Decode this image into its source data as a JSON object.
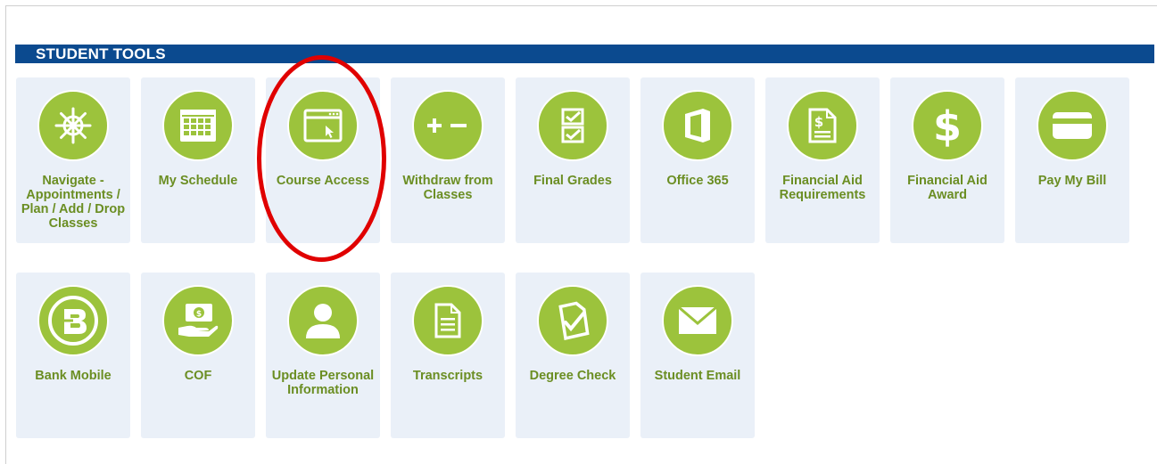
{
  "section": {
    "title": "STUDENT TOOLS"
  },
  "colors": {
    "header_bg": "#0b4a8f",
    "tile_bg": "#eaf0f8",
    "icon_circle": "#9cc33c",
    "label_text": "#6b8e23",
    "highlight": "#e00000"
  },
  "tools_row1": [
    {
      "label": "Navigate -\nAppointments /\nPlan / Add / Drop\nClasses",
      "icon": "ship-wheel-icon"
    },
    {
      "label": "My Schedule",
      "icon": "calendar-icon"
    },
    {
      "label": "Course Access",
      "icon": "browser-window-icon"
    },
    {
      "label": "Withdraw from\nClasses",
      "icon": "plus-minus-icon"
    },
    {
      "label": "Final Grades",
      "icon": "checklist-icon"
    },
    {
      "label": "Office 365",
      "icon": "office-icon"
    },
    {
      "label": "Financial Aid\nRequirements",
      "icon": "dollar-document-icon"
    },
    {
      "label": "Financial Aid\nAward",
      "icon": "dollar-icon"
    },
    {
      "label": "Pay My Bill",
      "icon": "credit-card-icon"
    }
  ],
  "tools_row2": [
    {
      "label": "Bank Mobile",
      "icon": "bank-mobile-logo-icon"
    },
    {
      "label": "COF",
      "icon": "hand-money-icon"
    },
    {
      "label": "Update Personal\nInformation",
      "icon": "person-icon"
    },
    {
      "label": "Transcripts",
      "icon": "document-icon"
    },
    {
      "label": "Degree Check",
      "icon": "document-check-icon"
    },
    {
      "label": "Student Email",
      "icon": "envelope-icon"
    }
  ]
}
